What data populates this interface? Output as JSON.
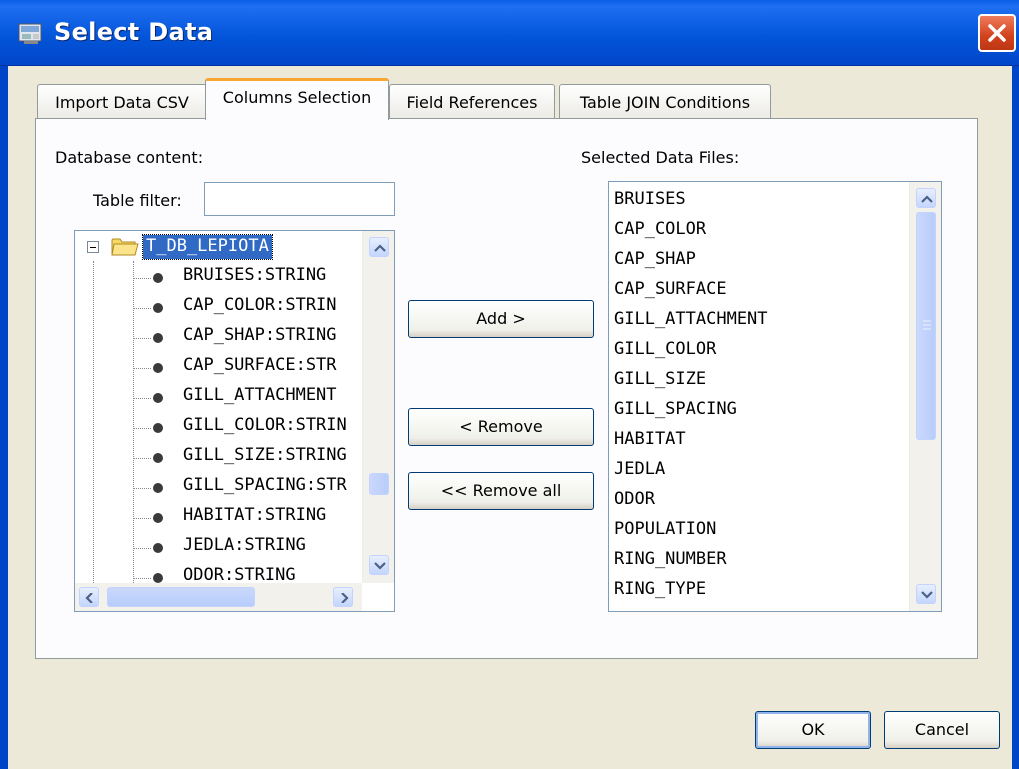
{
  "window": {
    "title": "Select Data"
  },
  "tabs": [
    {
      "label": "Import Data CSV"
    },
    {
      "label": "Columns Selection"
    },
    {
      "label": "Field References"
    },
    {
      "label": "Table JOIN Conditions"
    }
  ],
  "left": {
    "heading": "Database content:",
    "filter_label": "Table filter:",
    "filter_value": "",
    "tree": {
      "root": "T_DB_LEPIOTA",
      "children": [
        "BRUISES:STRING",
        "CAP_COLOR:STRIN",
        "CAP_SHAP:STRING",
        "CAP_SURFACE:STR",
        "GILL_ATTACHMENT",
        "GILL_COLOR:STRIN",
        "GILL_SIZE:STRING",
        "GILL_SPACING:STR",
        "HABITAT:STRING",
        "JEDLA:STRING",
        "ODOR:STRING"
      ]
    }
  },
  "buttons": {
    "add": "Add >",
    "remove": "< Remove",
    "remove_all": "<< Remove all",
    "ok": "OK",
    "cancel": "Cancel"
  },
  "right": {
    "heading": "Selected Data Files:",
    "items": [
      "BRUISES",
      "CAP_COLOR",
      "CAP_SHAP",
      "CAP_SURFACE",
      "GILL_ATTACHMENT",
      "GILL_COLOR",
      "GILL_SIZE",
      "GILL_SPACING",
      "HABITAT",
      "JEDLA",
      "ODOR",
      "POPULATION",
      "RING_NUMBER",
      "RING_TYPE"
    ]
  },
  "icons": {
    "app": "window-app-icon",
    "close": "close-icon",
    "folder": "folder-icon",
    "node": "tree-leaf-icon"
  },
  "colors": {
    "titlebar": "#0355d9",
    "active_tab_accent": "#f8a531",
    "selection": "#316ac5",
    "close_button": "#d2421c"
  }
}
